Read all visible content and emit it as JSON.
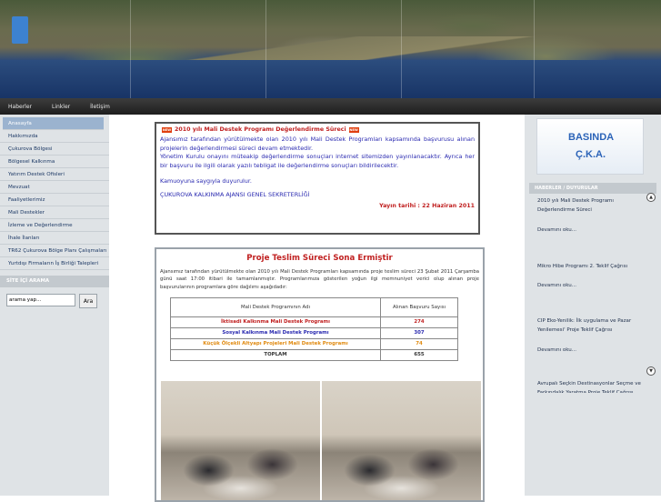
{
  "nav": {
    "items": [
      "Haberler",
      "Linkler",
      "İletişim"
    ]
  },
  "sidebar": {
    "items": [
      "Anasayfa",
      "Hakkımızda",
      "Çukurova Bölgesi",
      "Bölgesel Kalkınma",
      "Yatırım Destek Ofisleri",
      "Mevzuat",
      "Faaliyetlerimiz",
      "Mali Destekler",
      "İzleme ve Değerlendirme",
      "İhale İlanları",
      "TR62 Çukurova Bölge Planı Çalışmaları",
      "Yurtdışı Firmaların İş Birliği Talepleri"
    ],
    "search_heading": "SİTE İÇİ ARAMA",
    "search_value": "arama yap...",
    "search_button": "Ara"
  },
  "notice": {
    "badge": "NEW",
    "title": "2010 yılı Mali Destek Programı Değerlendirme Süreci",
    "p1": "Ajansımız tarafından yürütülmekte olan 2010 yılı Mali Destek Programları kapsamında başvurusu alınan projelerin değerlendirmesi süreci devam etmektedir.",
    "p2": "Yönetim Kurulu onayını müteakip değerlendirme sonuçları internet sitemizden yayınlanacaktır. Ayrıca her bir başvuru ile ilgili olarak yazılı tebligat ile değerlendirme sonuçları bildirilecektir.",
    "p3": "Kamuoyuna saygıyla duyurulur.",
    "p4": "ÇUKUROVA KALKINMA AJANSI GENEL SEKRETERLİĞİ",
    "date": "Yayın tarihi : 22 Haziran 2011"
  },
  "article": {
    "title": "Proje Teslim Süreci Sona Ermiştir",
    "body": "Ajansımız tarafından yürütülmekte olan 2010 yılı Mali Destek Programları kapsamında proje teslim süreci 23 Şubat 2011 Çarşamba günü saat 17:00 itibari ile tamamlanmıştır. Programlarımıza gösterilen yoğun ilgi memnuniyet verici olup alınan proje başvurularının programlara göre dağılımı aşağıdadır:",
    "table": {
      "headers": [
        "Mali Destek Programının Adı",
        "Alınan Başvuru Sayısı"
      ],
      "rows": [
        {
          "name": "İktisadi Kalkınma Mali Destek Programı",
          "count": "274",
          "color": "#c02020"
        },
        {
          "name": "Sosyal Kalkınma Mali Destek Programı",
          "count": "307",
          "color": "#2a2ab0"
        },
        {
          "name": "Küçük Ölçekli Altyapı Projeleri Mali Destek Programı",
          "count": "74",
          "color": "#e08a10"
        }
      ],
      "total_label": "TOPLAM",
      "total": "655"
    }
  },
  "right": {
    "press_line1": "BASINDA",
    "press_line2": "Ç.K.A.",
    "heading": "HABERLER / DUYURULAR",
    "news": [
      {
        "title": "2010 yılı Mali Destek Programı Değerlendirme Süreci",
        "more": "Devamını oku..."
      },
      {
        "title": "Mikro Hibe Programı 2. Teklif Çağrısı",
        "more": "Devamını oku..."
      },
      {
        "title": "CIP Eko-Yenilik: İlk uygulama ve Pazar Yenilemesi' Proje Teklif Çağrısı",
        "more": "Devamını oku..."
      },
      {
        "title": "Avrupalı Seçkin Destinasyonlar Seçme ve Farkındalık Yaratma Proje Teklif Çağrısı",
        "more": ""
      }
    ]
  }
}
